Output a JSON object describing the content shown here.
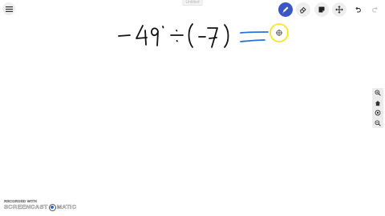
{
  "window": {
    "title": "Untitled"
  },
  "toolbar": {
    "menu_icon": "hamburger-menu-icon",
    "tools": [
      "pen-icon",
      "eraser-icon",
      "sticky-note-icon",
      "move-icon",
      "undo-icon",
      "redo-icon"
    ],
    "active_tool": "pen"
  },
  "side_panel": {
    "tools": [
      "zoom-in-icon",
      "home-icon",
      "target-icon",
      "zoom-out-icon"
    ]
  },
  "watermark": {
    "recorded_with": "RECORDED WITH",
    "brand_left": "SCREENCAST",
    "brand_right": "MATIC"
  },
  "colors": {
    "accent": "#3b57c6",
    "ink": "#111111",
    "pen_blue": "#2d6fd8",
    "cursor_ring": "#f3e600"
  }
}
